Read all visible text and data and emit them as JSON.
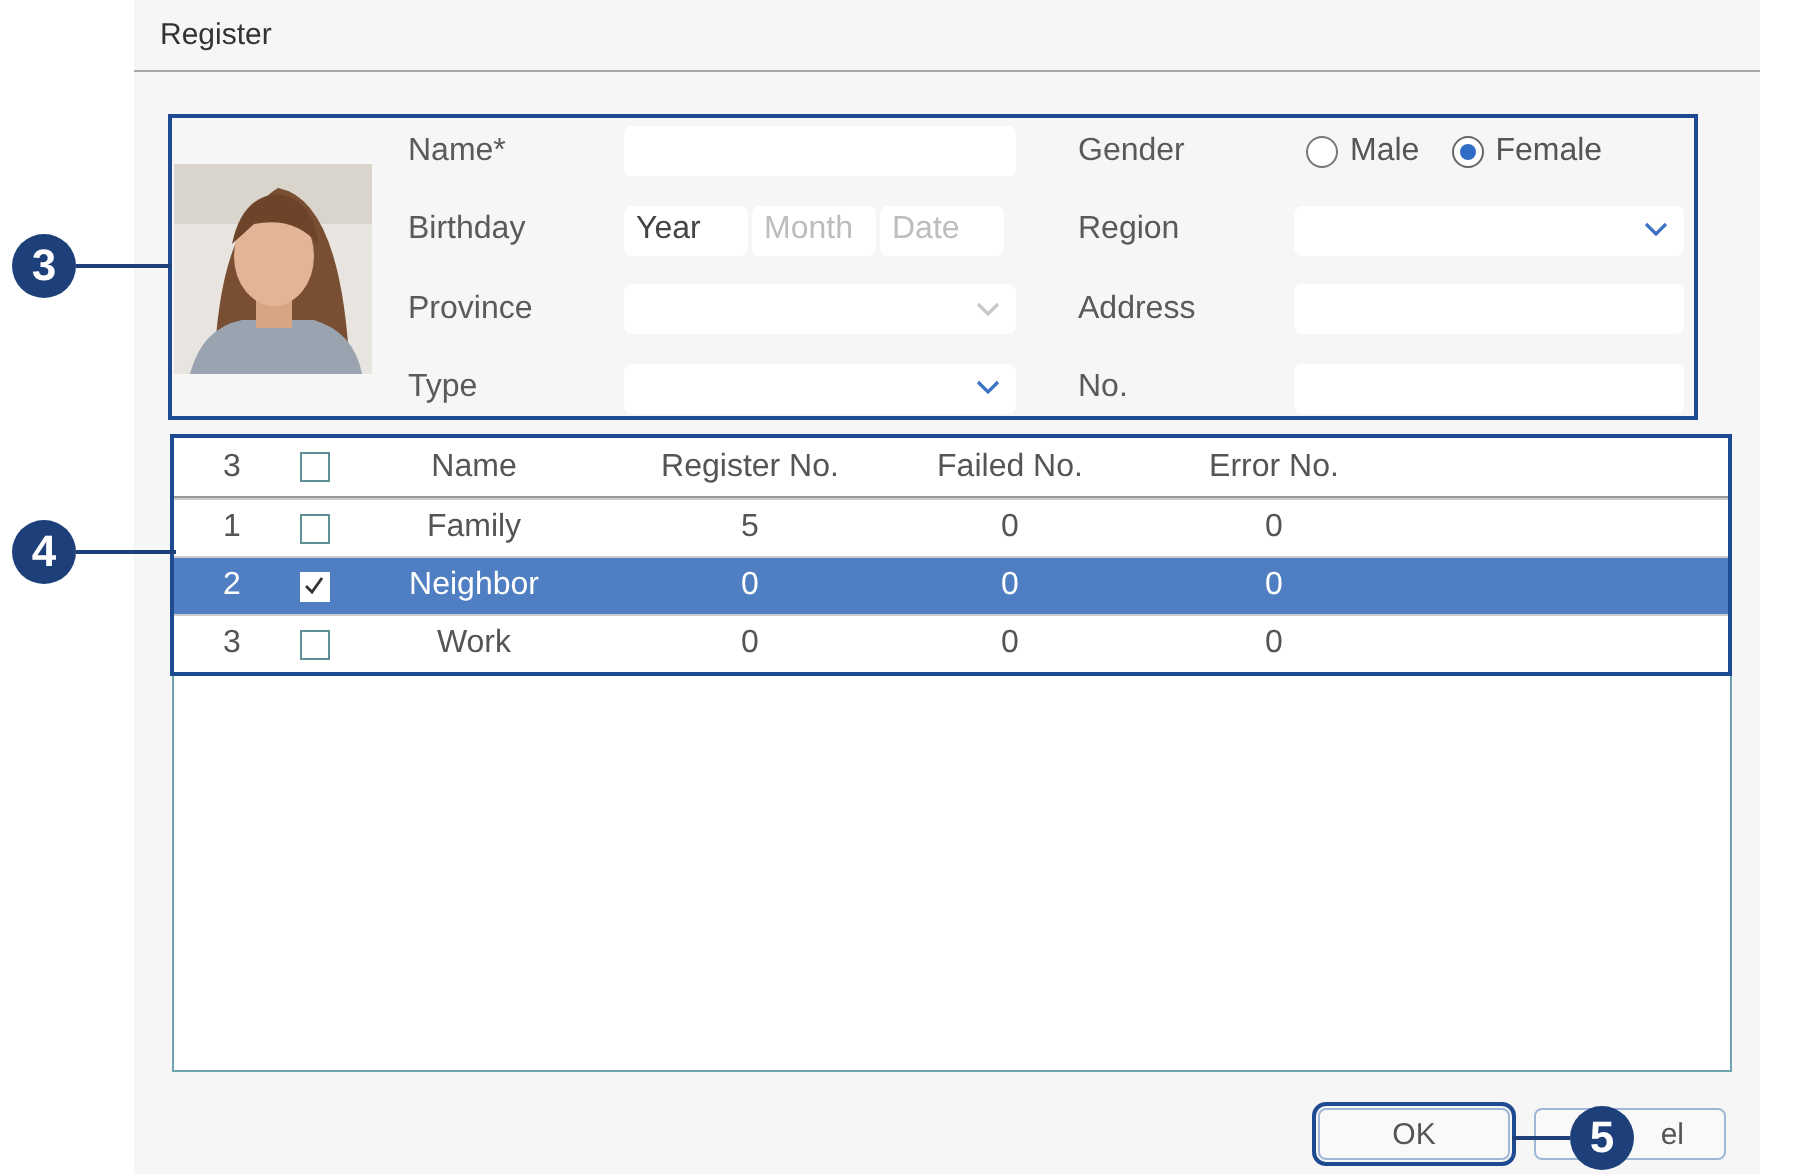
{
  "window": {
    "title": "Register"
  },
  "form": {
    "fields": [
      {
        "kind": "text",
        "label": "Name*"
      },
      {
        "kind": "radio",
        "label": "Gender",
        "options": [
          {
            "label": "Male",
            "selected": false
          },
          {
            "label": "Female",
            "selected": true
          }
        ]
      },
      {
        "kind": "date",
        "label": "Birthday",
        "parts": [
          {
            "placeholder": "Year",
            "disabled": false
          },
          {
            "placeholder": "Month",
            "disabled": true
          },
          {
            "placeholder": "Date",
            "disabled": true
          }
        ]
      },
      {
        "kind": "dropdown",
        "label": "Region",
        "disabled": false
      },
      {
        "kind": "dropdown",
        "label": "Province",
        "disabled": true
      },
      {
        "kind": "text",
        "label": "Address"
      },
      {
        "kind": "dropdown",
        "label": "Type",
        "disabled": false
      },
      {
        "kind": "text",
        "label": "No."
      }
    ]
  },
  "table": {
    "count": "3",
    "header_checked": false,
    "columns": [
      "Name",
      "Register No.",
      "Failed No.",
      "Error No."
    ],
    "rows": [
      {
        "index": "1",
        "checked": false,
        "selected": false,
        "cells": [
          "Family",
          "5",
          "0",
          "0"
        ]
      },
      {
        "index": "2",
        "checked": true,
        "selected": true,
        "cells": [
          "Neighbor",
          "0",
          "0",
          "0"
        ]
      },
      {
        "index": "3",
        "checked": false,
        "selected": false,
        "cells": [
          "Work",
          "0",
          "0",
          "0"
        ]
      }
    ]
  },
  "buttons": [
    {
      "label": "OK"
    },
    {
      "visible_parts": [
        "el"
      ]
    }
  ],
  "callouts": [
    {
      "number": "3"
    },
    {
      "number": "4"
    },
    {
      "number": "5"
    }
  ]
}
